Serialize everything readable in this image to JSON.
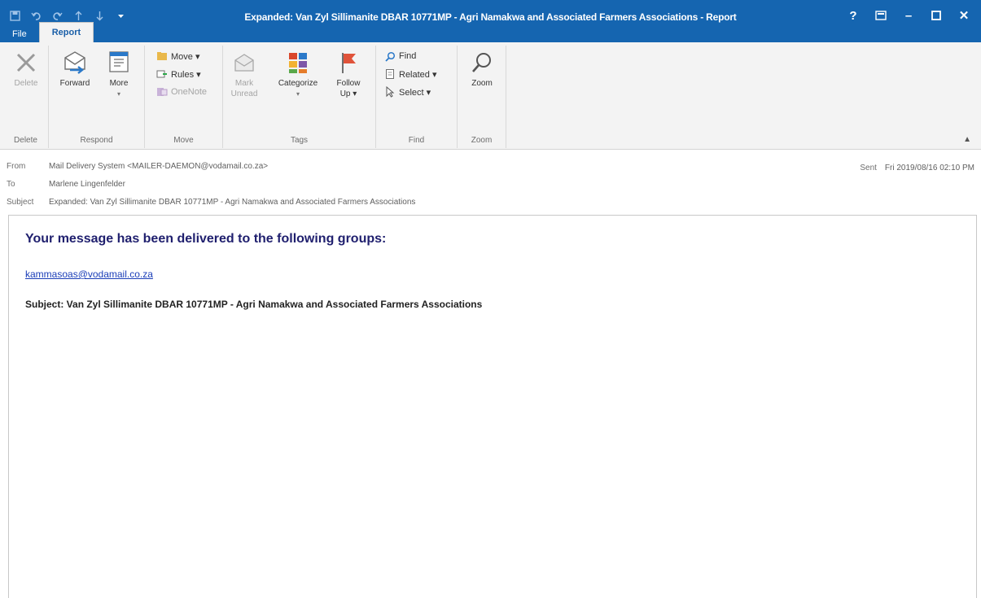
{
  "window": {
    "title": "Expanded: Van Zyl Sillimanite DBAR 10771MP - Agri Namakwa and Associated Farmers Associations - Report",
    "buttons": {
      "help": "?",
      "ribbon_options": "⊡",
      "minimize": "–",
      "maximize": "☐",
      "close": "✕"
    }
  },
  "quick_access": {
    "items": [
      "save-icon",
      "undo-icon",
      "redo-icon",
      "up-icon",
      "down-icon",
      "customize-icon"
    ]
  },
  "tabs": [
    {
      "label": "File"
    },
    {
      "label": "Report"
    }
  ],
  "ribbon": {
    "delete": {
      "button": "Delete",
      "group": "Delete"
    },
    "respond": {
      "forward": "Forward",
      "more": "More",
      "group": "Respond"
    },
    "move": {
      "move": "Move ▾",
      "rules": "Rules ▾",
      "onenote": "OneNote",
      "group": "Move"
    },
    "tags": {
      "mark_unread_1": "Mark",
      "mark_unread_2": "Unread",
      "categorize": "Categorize",
      "follow_up_1": "Follow",
      "follow_up_2": "Up ▾",
      "group": "Tags"
    },
    "find": {
      "find": "Find",
      "related": "Related ▾",
      "select": "Select ▾",
      "group": "Find"
    },
    "zoom": {
      "button": "Zoom",
      "group": "Zoom"
    }
  },
  "message": {
    "from_label": "From",
    "from_value": "Mail Delivery System <MAILER-DAEMON@vodamail.co.za>",
    "to_label": "To",
    "to_value": "Marlene Lingenfelder",
    "subject_label": "Subject",
    "subject_value": "Expanded: Van Zyl Sillimanite DBAR 10771MP - Agri Namakwa and Associated Farmers Associations",
    "sent_label": "Sent",
    "sent_value": "Fri 2019/08/16 02:10 PM"
  },
  "body": {
    "headline": "Your message has been delivered to the following groups:",
    "recipient": "kammasoas@vodamail.co.za",
    "subject_line": "Subject: Van Zyl Sillimanite DBAR 10771MP - Agri Namakwa and Associated Farmers Associations"
  },
  "colors": {
    "titlebar": "#1565b0",
    "ribbon": "#f3f3f3",
    "headline": "#1f1f6e",
    "link": "#1b3eb8",
    "flag": "#e0533a"
  }
}
